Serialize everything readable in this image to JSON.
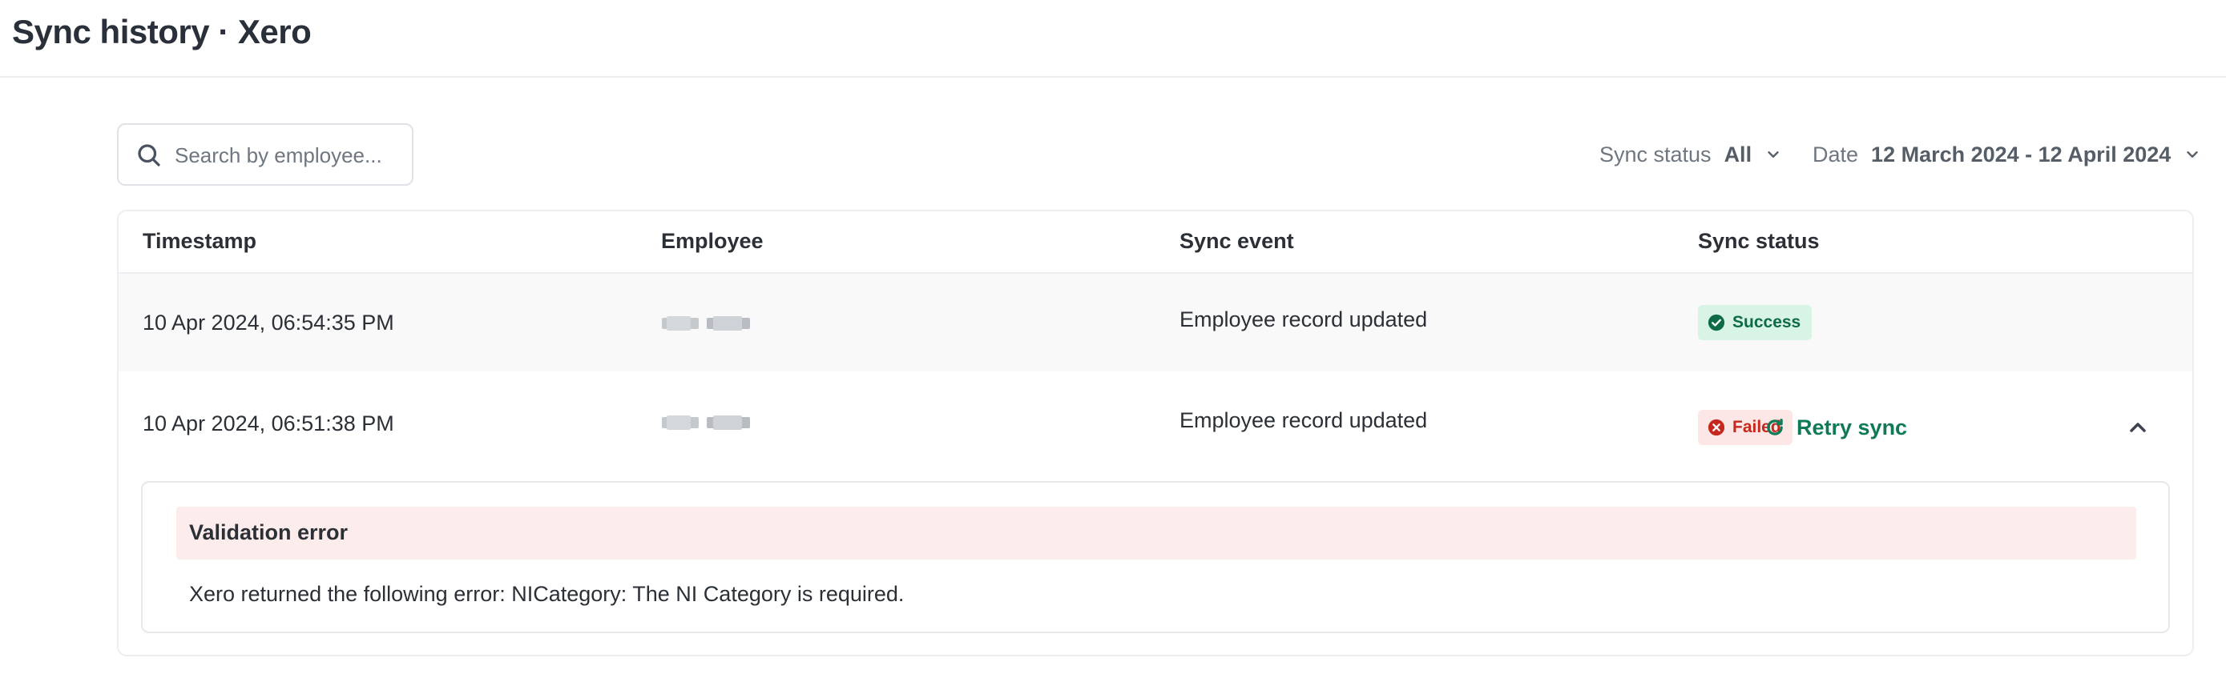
{
  "page": {
    "title": "Sync history · Xero"
  },
  "search": {
    "placeholder": "Search by employee..."
  },
  "filters": {
    "sync_status": {
      "label": "Sync status",
      "value": "All"
    },
    "date": {
      "label": "Date",
      "value": "12 March 2024 - 12 April 2024"
    }
  },
  "table": {
    "columns": [
      "Timestamp",
      "Employee",
      "Sync event",
      "Sync status"
    ],
    "rows": [
      {
        "timestamp": "10 Apr 2024, 06:54:35 PM",
        "employee": "",
        "event": "Employee record updated",
        "status": "Success"
      },
      {
        "timestamp": "10 Apr 2024, 06:51:38 PM",
        "employee": "",
        "event": "Employee record updated",
        "status": "Failed",
        "action": "Retry sync"
      }
    ]
  },
  "error": {
    "title": "Validation error",
    "message": "Xero returned the following error: NICategory: The NI Category is required."
  },
  "colors": {
    "success_bg": "#d7f4e4",
    "success_text": "#0e6b47",
    "failed_bg": "#fde6e6",
    "failed_text": "#c7281e",
    "accent": "#0f7a55",
    "error_panel_bg": "#fdecec"
  },
  "icons": {
    "search": "search-icon",
    "chevron": "chevron-down-icon",
    "success": "check-circle-icon",
    "failed": "x-circle-icon",
    "retry": "refresh-icon",
    "collapse": "chevron-up-icon"
  }
}
